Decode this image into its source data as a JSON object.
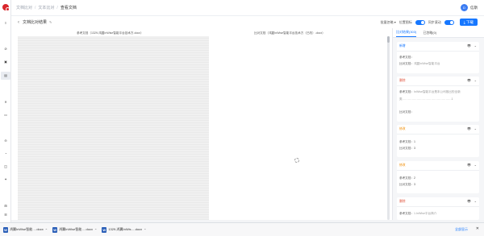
{
  "breadcrumb": [
    "文档比对",
    "文本比对",
    "查看文档"
  ],
  "user": {
    "avatar_text": "D",
    "name": "信斯"
  },
  "toolbar": {
    "title": "文档比对结果",
    "batch_label": "批量忽略",
    "location_label": "位置图标",
    "sync_label": "同步滚动",
    "download_label": "下载"
  },
  "docs": {
    "left_label": "参考文档（1329-鸿翼InWise智能平台技术方.docx）",
    "right_label": "比对文档（鸿翼InWise智能平台技术方（已改）.docx）"
  },
  "panel": {
    "tabs": [
      "比对结果(303)",
      "已忽略(0)"
    ],
    "cards": [
      {
        "type": "新增",
        "lines": [
          {
            "label": "参考文档：",
            "value": ""
          },
          {
            "label": "比对文档：",
            "value": "鸿翼InWise智能平台"
          }
        ]
      },
      {
        "type": "删除",
        "lines": [
          {
            "label": "参考文档：",
            "value": "InWise智能平台是本公司推出的全新"
          },
          {
            "label": "",
            "value": "类……………………………………………1"
          },
          {
            "label": "比对文档：",
            "value": ""
          }
        ]
      },
      {
        "type": "修改",
        "lines": [
          {
            "label": "参考文档：",
            "value": "1"
          },
          {
            "label": "比对文档：",
            "value": "3"
          }
        ]
      },
      {
        "type": "修改",
        "lines": [
          {
            "label": "参考文档：",
            "value": "2"
          },
          {
            "label": "比对文档：",
            "value": "3"
          }
        ]
      },
      {
        "type": "删除",
        "lines": [
          {
            "label": "参考文档：",
            "value": "1.InWise平台简介"
          }
        ]
      }
    ]
  },
  "taskbar": {
    "downloads": [
      "鸿翼InWise智能….docx",
      "鸿翼InWise智能….docx",
      "1329-鸿翼InWis….docx"
    ],
    "show_all": "全部显示"
  },
  "colors": {
    "accent": "#1677ff",
    "new": "#1677ff",
    "delete": "#e0533c",
    "modify": "#f08c00"
  }
}
